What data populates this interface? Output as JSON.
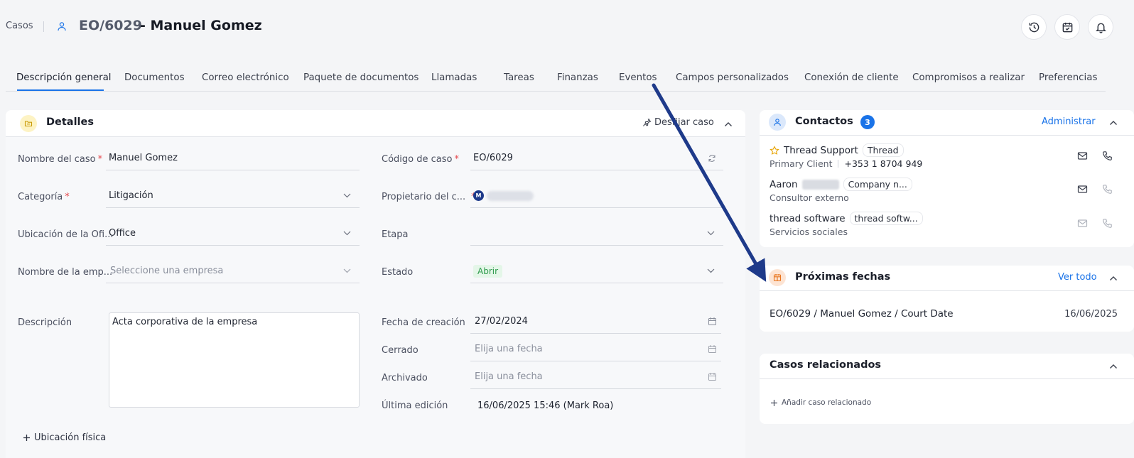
{
  "header": {
    "breadcrumb": "Casos",
    "case_code": "EO/6029",
    "case_name": "- Manuel Gomez",
    "icons": [
      "history-icon",
      "calendar-check-icon",
      "bell-icon"
    ]
  },
  "tabs": [
    "Descripción general",
    "Documentos",
    "Correo electrónico",
    "Paquete de documentos",
    "Llamadas",
    "Tareas",
    "Finanzas",
    "Eventos",
    "Campos personalizados",
    "Conexión de cliente",
    "Compromisos a realizar",
    "Preferencias"
  ],
  "details": {
    "title": "Detalles",
    "unpin_label": "Desfijar caso",
    "fields": {
      "case_name_label": "Nombre del caso",
      "case_name_value": "Manuel Gomez",
      "category_label": "Categoría",
      "category_value": "Litigación",
      "office_label": "Ubicación de la Ofi...",
      "office_value": "Office",
      "company_label": "Nombre de la emp...",
      "company_placeholder": "Seleccione una empresa",
      "description_label": "Descripción",
      "description_value": "Acta corporativa de la empresa",
      "code_label": "Código de caso",
      "code_value": "EO/6029",
      "owner_label": "Propietario del c...",
      "owner_initial": "M",
      "stage_label": "Etapa",
      "status_label": "Estado",
      "status_value": "Abrir",
      "created_label": "Fecha de creación",
      "created_value": "27/02/2024",
      "closed_label": "Cerrado",
      "closed_placeholder": "Elija una fecha",
      "archived_label": "Archivado",
      "archived_placeholder": "Elija una fecha",
      "last_edit_label": "Última edición",
      "last_edit_value": "16/06/2025 15:46 (Mark Roa)"
    },
    "add_physical_location": "Ubicación física"
  },
  "contacts": {
    "title": "Contactos",
    "count": "3",
    "manage_label": "Administrar",
    "items": [
      {
        "name": "Thread Support",
        "tag": "Thread",
        "role": "Primary Client",
        "phone": "+353 1 8704 949"
      },
      {
        "name": "Aaron",
        "tag": "Company n...",
        "role": "Consultor externo"
      },
      {
        "name": "thread software",
        "tag": "thread softw...",
        "role": "Servicios sociales"
      }
    ]
  },
  "upcoming": {
    "title": "Próximas fechas",
    "view_all": "Ver todo",
    "item": "EO/6029 / Manuel Gomez / Court Date",
    "date": "16/06/2025"
  },
  "related": {
    "title": "Casos relacionados",
    "add_label": "Añadir caso relacionado"
  },
  "colors": {
    "accent": "#1a73e8",
    "annotation_arrow": "#1e3a8a",
    "status_open_bg": "#e4f6e8",
    "status_open_text": "#2e9b4c"
  }
}
